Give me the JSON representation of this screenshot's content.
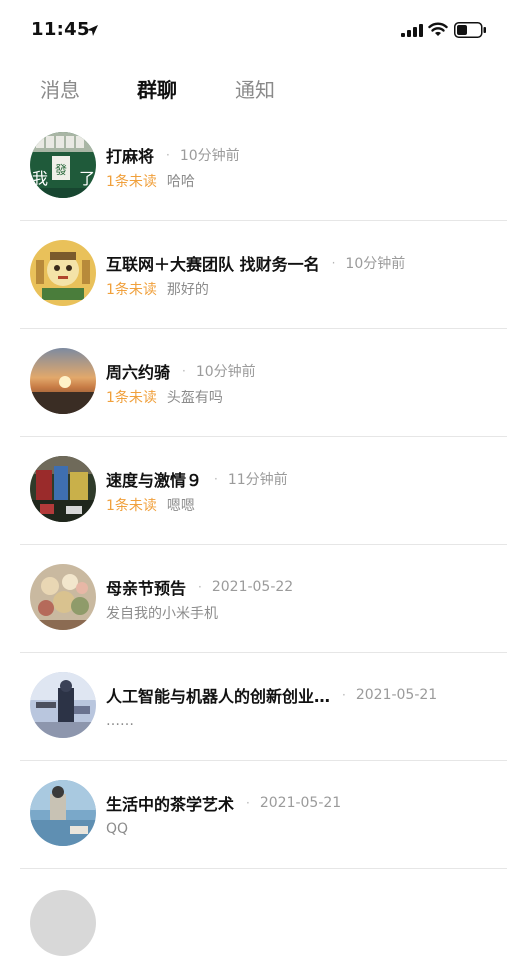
{
  "status_bar": {
    "time": "11:45",
    "icons": [
      "location-arrow-icon",
      "cellular-signal-icon",
      "wifi-icon",
      "battery-icon"
    ]
  },
  "tabs": [
    {
      "label": "消息",
      "active": false
    },
    {
      "label": "群聊",
      "active": true
    },
    {
      "label": "通知",
      "active": false
    }
  ],
  "colors": {
    "unread": "#f0a03c",
    "muted": "#9b9b9b",
    "divider": "#e6e6e6"
  },
  "groups": [
    {
      "name": "打麻将",
      "time": "10分钟前",
      "unread": "1条未读",
      "preview": "哈哈"
    },
    {
      "name": "互联网＋大赛团队 找财务一名",
      "time": "10分钟前",
      "unread": "1条未读",
      "preview": "那好的"
    },
    {
      "name": "周六约骑",
      "time": "10分钟前",
      "unread": "1条未读",
      "preview": "头盔有吗"
    },
    {
      "name": "速度与激情９",
      "time": "11分钟前",
      "unread": "1条未读",
      "preview": "嗯嗯"
    },
    {
      "name": "母亲节预告",
      "time": "2021-05-22",
      "unread": "",
      "preview": "发自我的小米手机"
    },
    {
      "name": "人工智能与机器人的创新创业…",
      "time": "2021-05-21",
      "unread": "",
      "preview": "……"
    },
    {
      "name": "生活中的茶学艺术",
      "time": "2021-05-21",
      "unread": "",
      "preview": "QQ"
    }
  ]
}
